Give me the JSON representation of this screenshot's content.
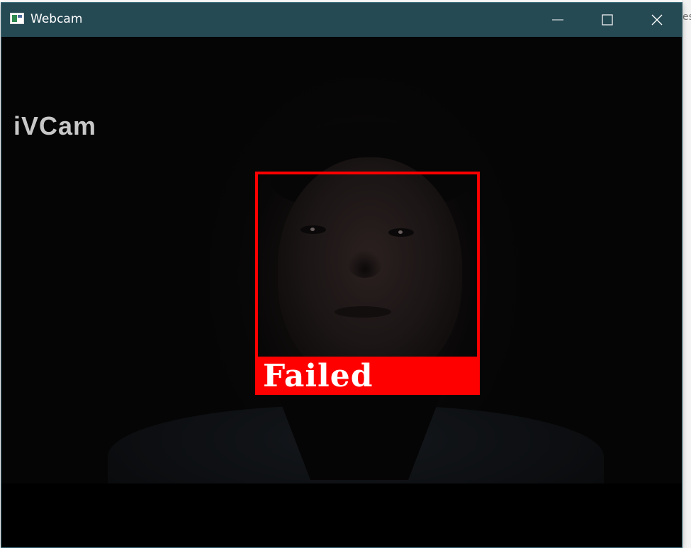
{
  "window": {
    "title": "Webcam",
    "icon": "app-window-icon",
    "controls": {
      "minimize_icon": "minimize-icon",
      "maximize_icon": "maximize-icon",
      "close_icon": "close-icon"
    },
    "titlebar_color": "#264a54"
  },
  "video": {
    "watermark": "iVCam",
    "detection": {
      "label": "Failed",
      "box_color": "#ff0000",
      "label_text_color": "#ffffff"
    }
  },
  "background": {
    "partial_text": "es"
  }
}
